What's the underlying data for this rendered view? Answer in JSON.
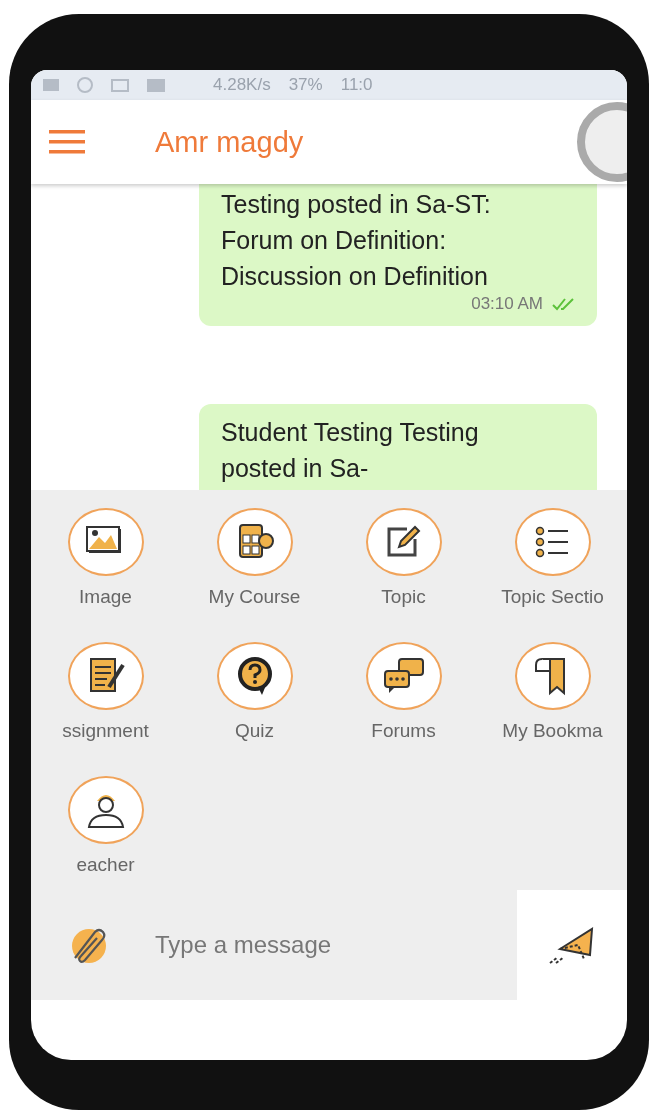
{
  "status_bar": {
    "speed": "4.28K/s",
    "battery": "37%",
    "time": "11:0"
  },
  "header": {
    "title": "Amr magdy"
  },
  "messages": [
    {
      "text": "Testing posted in Sa-ST: Forum on Definition: Discussion on Definition",
      "time": "03:10 AM",
      "read": true
    },
    {
      "text": "Student Testing Testing posted in Sa-"
    }
  ],
  "attach_menu": [
    {
      "label": "Image"
    },
    {
      "label": "My Course"
    },
    {
      "label": "Topic"
    },
    {
      "label": "Topic Sectio"
    },
    {
      "label": "ssignment"
    },
    {
      "label": "Quiz"
    },
    {
      "label": "Forums"
    },
    {
      "label": "My Bookma"
    },
    {
      "label": "eacher"
    }
  ],
  "composer": {
    "placeholder": "Type a message"
  }
}
